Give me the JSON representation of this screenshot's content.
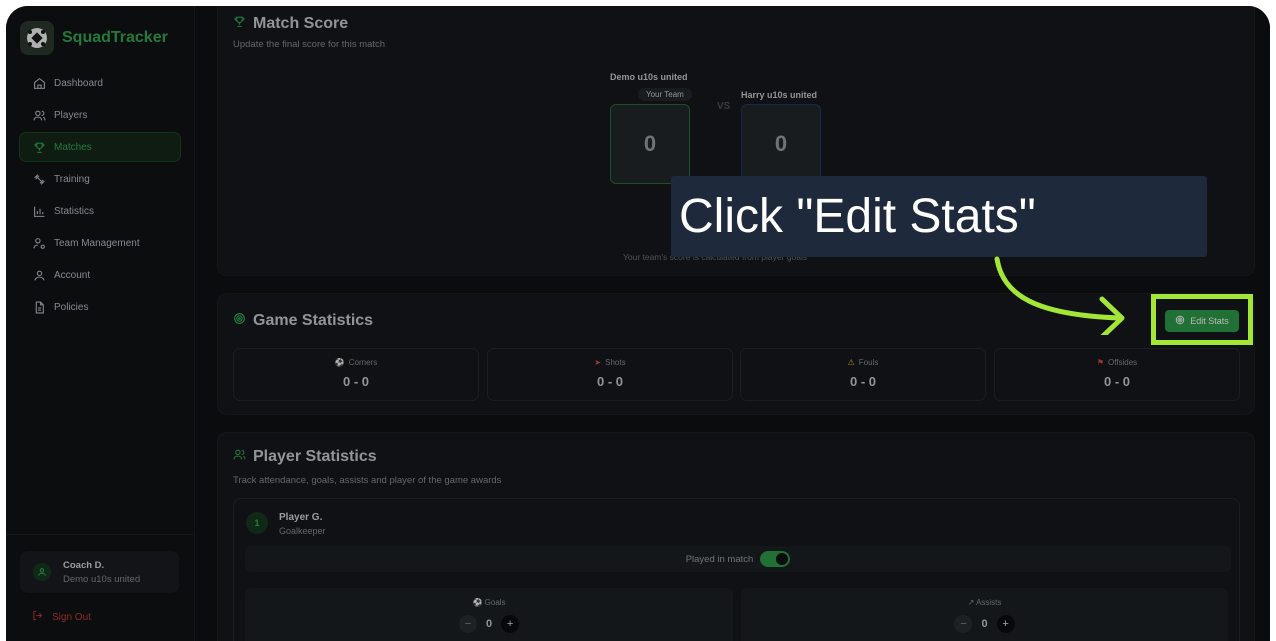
{
  "brand": {
    "name": "SquadTracker"
  },
  "nav": {
    "items": [
      {
        "label": "Dashboard",
        "icon": "home-icon"
      },
      {
        "label": "Players",
        "icon": "users-icon"
      },
      {
        "label": "Matches",
        "icon": "trophy-icon",
        "active": true
      },
      {
        "label": "Training",
        "icon": "dumbbell-icon"
      },
      {
        "label": "Statistics",
        "icon": "bar-chart-icon"
      },
      {
        "label": "Team Management",
        "icon": "user-cog-icon"
      },
      {
        "label": "Account",
        "icon": "user-icon"
      },
      {
        "label": "Policies",
        "icon": "document-icon"
      }
    ]
  },
  "user": {
    "name": "Coach D.",
    "team": "Demo u10s united"
  },
  "signout": {
    "label": "Sign Out"
  },
  "match_score": {
    "title": "Match Score",
    "subtitle": "Update the final score for this match",
    "home": {
      "name": "Demo u10s united",
      "badge": "Your Team",
      "score": "0"
    },
    "vs": "VS",
    "away": {
      "name": "Harry u10s united",
      "score": "0"
    },
    "hint": "Your team's score is calculated from player goals"
  },
  "game_stats": {
    "title": "Game Statistics",
    "edit_label": "Edit Stats",
    "items": [
      {
        "label": "Corners",
        "icon": "football-icon",
        "value": "0 - 0"
      },
      {
        "label": "Shots",
        "icon": "target-icon",
        "value": "0 - 0"
      },
      {
        "label": "Fouls",
        "icon": "warning-icon",
        "value": "0 - 0"
      },
      {
        "label": "Offsides",
        "icon": "flag-icon",
        "value": "0 - 0"
      }
    ]
  },
  "player_stats": {
    "title": "Player Statistics",
    "subtitle": "Track attendance, goals, assists and player of the game awards",
    "player": {
      "number": "1",
      "name": "Player G.",
      "position": "Goalkeeper",
      "played_label": "Played in match",
      "played": true,
      "goals_label": "Goals",
      "goals": "0",
      "assists_label": "Assists",
      "assists": "0"
    }
  },
  "overlay": {
    "instruction": "Click \"Edit Stats\"",
    "highlight_color": "#a3e635"
  },
  "colors": {
    "accent": "#35a853",
    "button": "#2f9b4a",
    "danger": "#c73b3b",
    "background": "#0f1114"
  }
}
